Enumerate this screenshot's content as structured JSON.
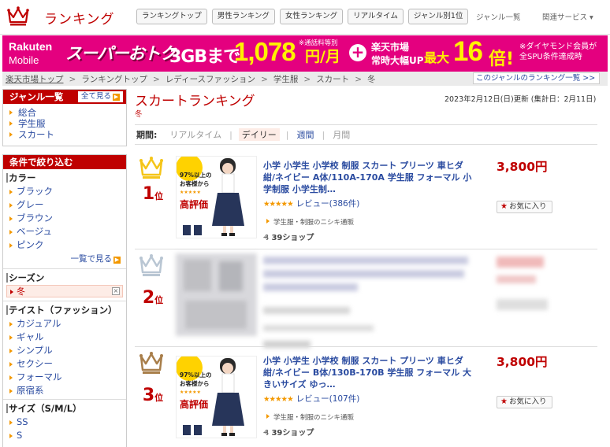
{
  "header": {
    "title": "ランキング",
    "tabs": [
      "ランキングトップ",
      "男性ランキング",
      "女性ランキング",
      "リアルタイム",
      "ジャンル別1位"
    ],
    "genre_list": "ジャンル一覧",
    "related": "関連サービス ▾"
  },
  "banner": {
    "logo_top": "Rakuten",
    "logo_bottom": "Mobile",
    "super": "スーパーおトク",
    "gb": "3GBまで",
    "price": "1,078",
    "yen": "円/月",
    "note1": "※通話料等別",
    "plus": "+",
    "ichiba1": "楽天市場",
    "ichiba2": "常時大幅UP",
    "max": "最大",
    "big": "16",
    "bai": "倍!",
    "note2_line1": "※ダイヤモンド会員が",
    "note2_line2": "全SPU条件達成時"
  },
  "breadcrumb": {
    "items": [
      "楽天市場トップ",
      "ランキングトップ",
      "レディースファッション",
      "学生服",
      "スカート",
      "冬"
    ],
    "sep": ">",
    "genre_ranking_link": "このジャンルのランキング一覧 >>"
  },
  "sidebar": {
    "genre": {
      "heading": "ジャンル一覧",
      "see_all": "全て見る",
      "items": [
        "総合",
        "学生服",
        "スカート"
      ]
    },
    "filter_heading": "条件で絞り込む",
    "color": {
      "title": "カラー",
      "items": [
        "ブラック",
        "グレー",
        "ブラウン",
        "ベージュ",
        "ピンク"
      ],
      "more": "一覧で見る"
    },
    "season": {
      "title": "シーズン",
      "selected": "冬",
      "clear": "×"
    },
    "taste": {
      "title": "テイスト（ファッション）",
      "items": [
        "カジュアル",
        "ギャル",
        "シンプル",
        "セクシー",
        "フォーマル",
        "原宿系"
      ]
    },
    "size": {
      "title": "サイズ（S/M/L）",
      "items": [
        "SS",
        "S"
      ]
    }
  },
  "main": {
    "title": "スカートランキング",
    "subtitle": "冬",
    "date": "2023年2月12日(日)更新 (集計日：2月11日)",
    "period_label": "期間:",
    "periods": [
      "リアルタイム",
      "デイリー",
      "週間",
      "月間"
    ],
    "active_period": "デイリー"
  },
  "items": [
    {
      "rank": "1",
      "rank_suffix": "位",
      "crown_color": "#f5c518",
      "name": "小学 小学生 小学校 制服 スカート プリーツ 車ヒダ 紺/ネイビー A体/110A-170A 学生服 フォーマル 小学制服 小学生制…",
      "stars_text": "★★★★★",
      "review": "レビュー(386件)",
      "shop": "学生服・制服のニシキ通販",
      "shop39": "39ショップ",
      "price": "3,800円",
      "fav": "お気に入り",
      "thumb_badge": "97%以上の",
      "thumb_line2": "お客様から",
      "thumb_big": "高評価"
    },
    {
      "rank": "2",
      "rank_suffix": "位",
      "crown_color": "#b9c6d3",
      "blurred": true
    },
    {
      "rank": "3",
      "rank_suffix": "位",
      "crown_color": "#a87e4a",
      "name": "小学 小学生 小学校 制服 スカート プリーツ 車ヒダ 紺/ネイビー B体/130B-170B 学生服 フォーマル 大きいサイズ ゆっ…",
      "stars_text": "★★★★★",
      "review": "レビュー(107件)",
      "shop": "学生服・制服のニシキ通販",
      "shop39": "39ショップ",
      "price": "3,800円",
      "fav": "お気に入り",
      "thumb_badge": "97%以上の",
      "thumb_line2": "お客様から",
      "thumb_big": "高評価"
    }
  ]
}
